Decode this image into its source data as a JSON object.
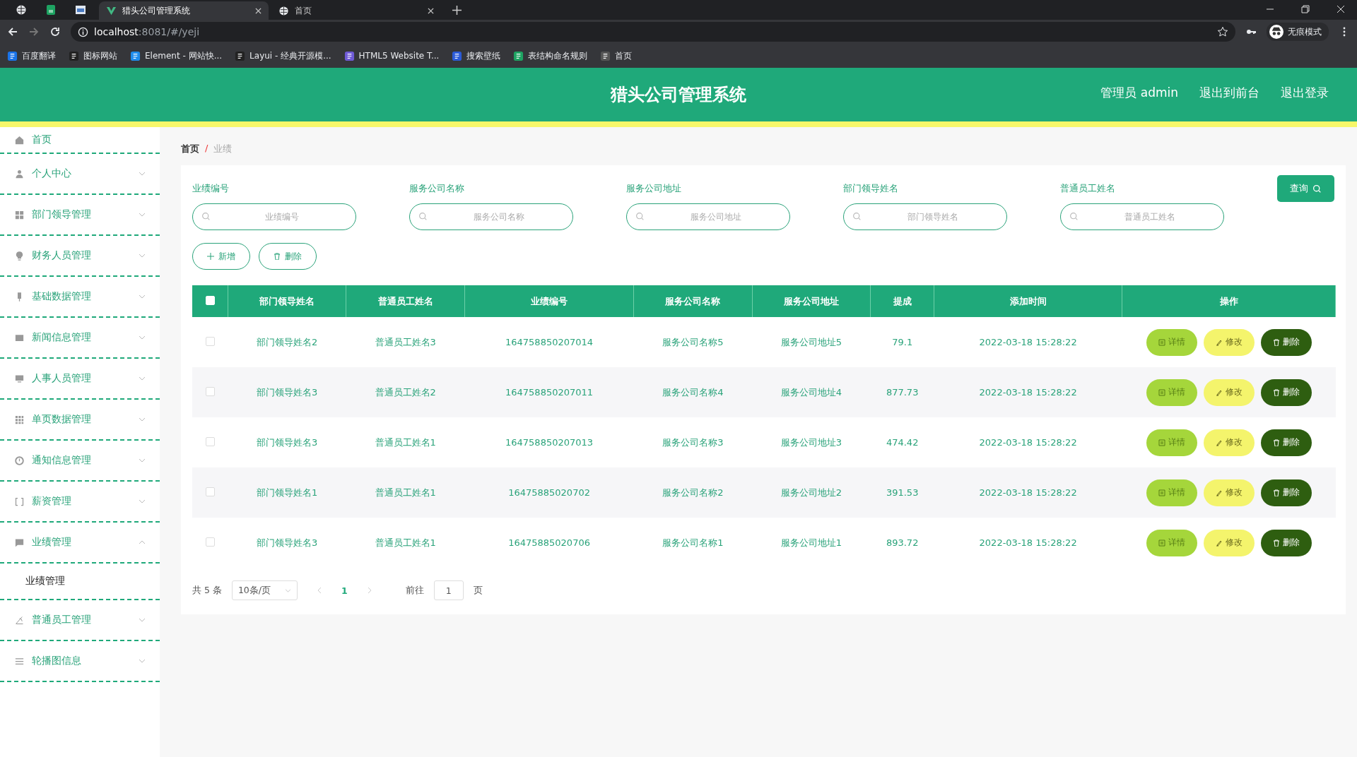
{
  "browser": {
    "tabs": [
      {
        "title": "猎头公司管理系统",
        "selected": true
      },
      {
        "title": "首页",
        "selected": false
      }
    ],
    "address": {
      "host": "localhost",
      "path": ":8081/#/yeji"
    },
    "profile": "无痕模式",
    "bookmarks": [
      "百度翻译",
      "图标网站",
      "Element - 网站快...",
      "Layui - 经典开源模...",
      "HTML5 Website T...",
      "搜索壁纸",
      "表结构命名规则",
      "首页"
    ]
  },
  "header": {
    "title": "猎头公司管理系统",
    "links": [
      "管理员 admin",
      "退出到前台",
      "退出登录"
    ]
  },
  "sidebar": {
    "items": [
      {
        "label": "首页",
        "kind": "link"
      },
      {
        "label": "个人中心",
        "kind": "menu",
        "expanded": false
      },
      {
        "label": "部门领导管理",
        "kind": "menu",
        "expanded": false
      },
      {
        "label": "财务人员管理",
        "kind": "menu",
        "expanded": false
      },
      {
        "label": "基础数据管理",
        "kind": "menu",
        "expanded": false
      },
      {
        "label": "新闻信息管理",
        "kind": "menu",
        "expanded": false
      },
      {
        "label": "人事人员管理",
        "kind": "menu",
        "expanded": false
      },
      {
        "label": "单页数据管理",
        "kind": "menu",
        "expanded": false
      },
      {
        "label": "通知信息管理",
        "kind": "menu",
        "expanded": false
      },
      {
        "label": "薪资管理",
        "kind": "menu",
        "expanded": false
      },
      {
        "label": "业绩管理",
        "kind": "menu",
        "expanded": true,
        "children": [
          {
            "label": "业绩管理"
          }
        ]
      },
      {
        "label": "普通员工管理",
        "kind": "menu",
        "expanded": false
      },
      {
        "label": "轮播图信息",
        "kind": "menu",
        "expanded": false
      }
    ]
  },
  "breadcrumb": [
    "首页",
    "业绩"
  ],
  "breadcrumb_separator": "/",
  "search": {
    "fields": [
      {
        "label": "业绩编号",
        "placeholder": "业绩编号"
      },
      {
        "label": "服务公司名称",
        "placeholder": "服务公司名称"
      },
      {
        "label": "服务公司地址",
        "placeholder": "服务公司地址"
      },
      {
        "label": "部门领导姓名",
        "placeholder": "部门领导姓名"
      },
      {
        "label": "普通员工姓名",
        "placeholder": "普通员工姓名"
      }
    ],
    "button": "查询"
  },
  "actions": [
    "新增",
    "删除"
  ],
  "table": {
    "select_all": {
      "checked": false
    },
    "columns": [
      "部门领导姓名",
      "普通员工姓名",
      "业绩编号",
      "服务公司名称",
      "服务公司地址",
      "提成",
      "添加时间",
      "操作"
    ],
    "rows": [
      {
        "checked": false,
        "cells": [
          "部门领导姓名2",
          "普通员工姓名3",
          "164758850207014",
          "服务公司名称5",
          "服务公司地址5",
          "79.1",
          "2022-03-18 15:28:22"
        ],
        "actions": [
          "详情",
          "修改",
          "删除"
        ]
      },
      {
        "checked": false,
        "cells": [
          "部门领导姓名3",
          "普通员工姓名2",
          "164758850207011",
          "服务公司名称4",
          "服务公司地址4",
          "877.73",
          "2022-03-18 15:28:22"
        ],
        "actions": [
          "详情",
          "修改",
          "删除"
        ]
      },
      {
        "checked": false,
        "cells": [
          "部门领导姓名3",
          "普通员工姓名1",
          "164758850207013",
          "服务公司名称3",
          "服务公司地址3",
          "474.42",
          "2022-03-18 15:28:22"
        ],
        "actions": [
          "详情",
          "修改",
          "删除"
        ]
      },
      {
        "checked": false,
        "cells": [
          "部门领导姓名1",
          "普通员工姓名1",
          "16475885020702",
          "服务公司名称2",
          "服务公司地址2",
          "391.53",
          "2022-03-18 15:28:22"
        ],
        "actions": [
          "详情",
          "修改",
          "删除"
        ]
      },
      {
        "checked": false,
        "cells": [
          "部门领导姓名3",
          "普通员工姓名1",
          "16475885020706",
          "服务公司名称1",
          "服务公司地址1",
          "893.72",
          "2022-03-18 15:28:22"
        ],
        "actions": [
          "详情",
          "修改",
          "删除"
        ]
      }
    ]
  },
  "pagination": {
    "total": "共 5 条",
    "page_size": "10条/页",
    "pages": [
      {
        "label": "1",
        "selected": true
      }
    ],
    "goto_label": "前往",
    "goto_value": "1",
    "goto_unit": "页"
  }
}
